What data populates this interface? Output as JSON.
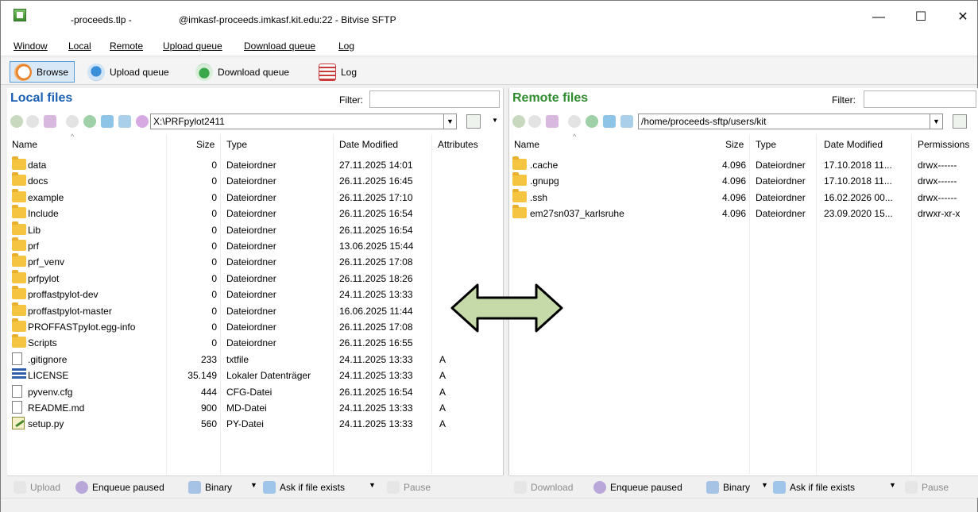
{
  "window": {
    "title_left": "-proceeds.tlp -",
    "title_main": "@imkasf-proceeds.imkasf.kit.edu:22 - Bitvise SFTP",
    "minimize": "—",
    "maximize": "☐",
    "close": "✕"
  },
  "menu": [
    "Window",
    "Local",
    "Remote",
    "Upload queue",
    "Download queue",
    "Log"
  ],
  "toolbar": {
    "browse": "Browse",
    "upload_queue": "Upload queue",
    "download_queue": "Download queue",
    "log": "Log"
  },
  "local": {
    "title": "Local files",
    "filter_label": "Filter:",
    "path": "X:\\PRFpylot2411",
    "columns": [
      "Name",
      "Size",
      "Type",
      "Date Modified",
      "Attributes"
    ],
    "rows": [
      {
        "icon": "folder",
        "name": "data",
        "size": "0",
        "type": "Dateiordner",
        "date": "27.11.2025 14:01",
        "attr": ""
      },
      {
        "icon": "folder",
        "name": "docs",
        "size": "0",
        "type": "Dateiordner",
        "date": "26.11.2025 16:45",
        "attr": ""
      },
      {
        "icon": "folder",
        "name": "example",
        "size": "0",
        "type": "Dateiordner",
        "date": "26.11.2025 17:10",
        "attr": ""
      },
      {
        "icon": "folder",
        "name": "Include",
        "size": "0",
        "type": "Dateiordner",
        "date": "26.11.2025 16:54",
        "attr": ""
      },
      {
        "icon": "folder",
        "name": "Lib",
        "size": "0",
        "type": "Dateiordner",
        "date": "26.11.2025 16:54",
        "attr": ""
      },
      {
        "icon": "folder",
        "name": "prf",
        "size": "0",
        "type": "Dateiordner",
        "date": "13.06.2025 15:44",
        "attr": ""
      },
      {
        "icon": "folder",
        "name": "prf_venv",
        "size": "0",
        "type": "Dateiordner",
        "date": "26.11.2025 17:08",
        "attr": ""
      },
      {
        "icon": "folder",
        "name": "prfpylot",
        "size": "0",
        "type": "Dateiordner",
        "date": "26.11.2025 18:26",
        "attr": ""
      },
      {
        "icon": "folder",
        "name": "proffastpylot-dev",
        "size": "0",
        "type": "Dateiordner",
        "date": "24.11.2025 13:33",
        "attr": ""
      },
      {
        "icon": "folder",
        "name": "proffastpylot-master",
        "size": "0",
        "type": "Dateiordner",
        "date": "16.06.2025 11:44",
        "attr": ""
      },
      {
        "icon": "folder",
        "name": "PROFFASTpylot.egg-info",
        "size": "0",
        "type": "Dateiordner",
        "date": "26.11.2025 17:08",
        "attr": ""
      },
      {
        "icon": "folder",
        "name": "Scripts",
        "size": "0",
        "type": "Dateiordner",
        "date": "26.11.2025 16:55",
        "attr": ""
      },
      {
        "icon": "file",
        "name": ".gitignore",
        "size": "233",
        "type": "txtfile",
        "date": "24.11.2025 13:33",
        "attr": "A"
      },
      {
        "icon": "cert",
        "name": "LICENSE",
        "size": "35.149",
        "type": "Lokaler Datenträger",
        "date": "24.11.2025 13:33",
        "attr": "A"
      },
      {
        "icon": "file",
        "name": "pyvenv.cfg",
        "size": "444",
        "type": "CFG-Datei",
        "date": "26.11.2025 16:54",
        "attr": "A"
      },
      {
        "icon": "file",
        "name": "README.md",
        "size": "900",
        "type": "MD-Datei",
        "date": "24.11.2025 13:33",
        "attr": "A"
      },
      {
        "icon": "py",
        "name": "setup.py",
        "size": "560",
        "type": "PY-Datei",
        "date": "24.11.2025 13:33",
        "attr": "A"
      }
    ],
    "bottom": {
      "action": "Upload",
      "enqueue": "Enqueue paused",
      "binary": "Binary",
      "exists": "Ask if file exists",
      "pause": "Pause"
    }
  },
  "remote": {
    "title": "Remote files",
    "filter_label": "Filter:",
    "path": "/home/proceeds-sftp/users/kit",
    "columns": [
      "Name",
      "Size",
      "Type",
      "Date Modified",
      "Permissions"
    ],
    "rows": [
      {
        "icon": "folder",
        "name": ".cache",
        "size": "4.096",
        "type": "Dateiordner",
        "date": "17.10.2018 11...",
        "perm": "drwx------"
      },
      {
        "icon": "folder",
        "name": ".gnupg",
        "size": "4.096",
        "type": "Dateiordner",
        "date": "17.10.2018 11...",
        "perm": "drwx------"
      },
      {
        "icon": "folder",
        "name": ".ssh",
        "size": "4.096",
        "type": "Dateiordner",
        "date": "16.02.2026 00...",
        "perm": "drwx------"
      },
      {
        "icon": "folder",
        "name": "em27sn037_karlsruhe",
        "size": "4.096",
        "type": "Dateiordner",
        "date": "23.09.2020 15...",
        "perm": "drwxr-xr-x"
      }
    ],
    "bottom": {
      "action": "Download",
      "enqueue": "Enqueue paused",
      "binary": "Binary",
      "exists": "Ask if file exists",
      "pause": "Pause"
    }
  },
  "colors": {
    "local_title": "#1a5fb4",
    "remote_title": "#2d8a2d",
    "arrow_fill": "#c6d9a8"
  }
}
